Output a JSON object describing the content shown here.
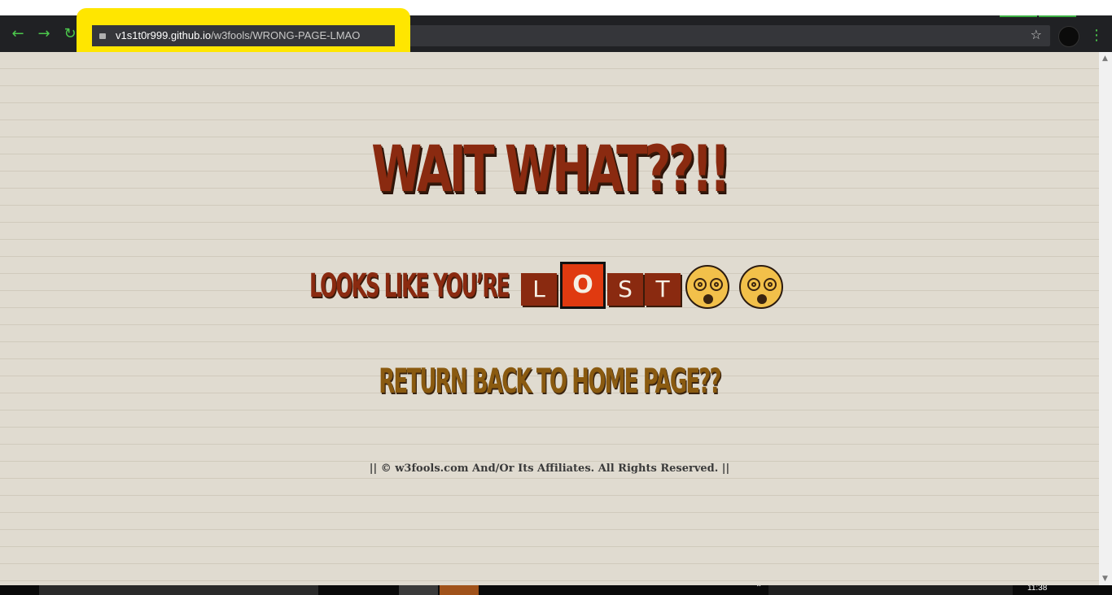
{
  "browser": {
    "url_host": "v1s1t0r999.github.io",
    "url_path": "/w3fools/WRONG-PAGE-LMAO",
    "back_icon": "arrow-left-icon",
    "forward_icon": "arrow-right-icon",
    "reload_icon": "reload-icon",
    "star_icon": "star-icon",
    "menu_icon": "kebab-menu-icon",
    "accent_color": "#4cc84c",
    "highlight_color": "#ffe600"
  },
  "page": {
    "headline": "WAIT WHAT??!!",
    "subline_lead": "LOOKS LIKE YOU’RE",
    "tiles": [
      "L",
      "O",
      "S",
      "T"
    ],
    "active_tile_index": 1,
    "emoji": [
      "dizzy-face-icon",
      "dizzy-face-icon"
    ],
    "return_link": "RETURN BACK TO HOME PAGE??",
    "footer": "|| © w3fools.com And/Or Its Affiliates. All Rights Reserved. ||",
    "primary_color": "#8a2a10",
    "link_color": "#8a5a10",
    "background_color": "#e0dbd0"
  },
  "taskbar": {
    "clock": "11:38"
  }
}
